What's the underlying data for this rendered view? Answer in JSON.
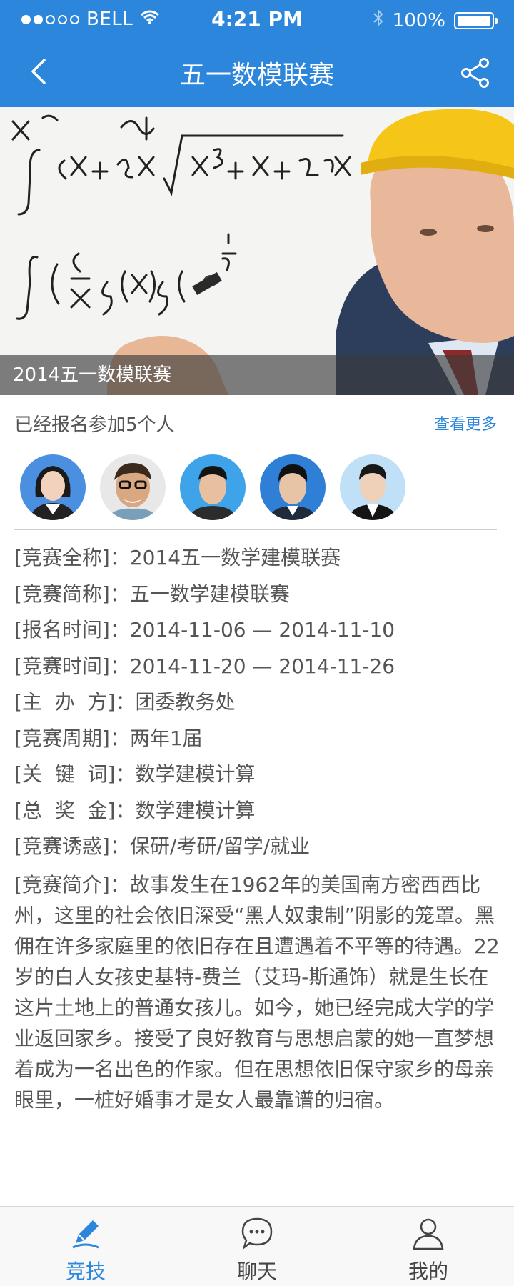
{
  "status_bar": {
    "carrier": "BELL",
    "time": "4:21 PM",
    "battery": "100%"
  },
  "nav": {
    "title": "五一数模联赛"
  },
  "banner": {
    "caption": "2014五一数模联赛"
  },
  "participants": {
    "count_text": "已经报名参加5个人",
    "more_label": "查看更多"
  },
  "details": [
    "[竞赛全称]：2014五一数学建模联赛",
    "[竞赛简称]：五一数学建模联赛",
    "[报名时间]：2014-11-06 — 2014-11-10",
    "[竞赛时间]：2014-11-20 — 2014-11-26",
    "[主  办  方]：团委教务处",
    "[竞赛周期]：两年1届",
    "[关  键  词]：数学建模计算",
    "[总  奖  金]：数学建模计算",
    "[竞赛诱惑]：保研/考研/留学/就业"
  ],
  "intro": "[竞赛简介]：故事发生在1962年的美国南方密西西比州，这里的社会依旧深受“黑人奴隶制”阴影的笼罩。黑佣在许多家庭里的依旧存在且遭遇着不平等的待遇。22岁的白人女孩史基特-费兰（艾玛-斯通饰）就是生长在这片土地上的普通女孩儿。如今，她已经完成大学的学业返回家乡。接受了良好教育与思想启蒙的她一直梦想着成为一名出色的作家。但在思想依旧保守家乡的母亲眼里，一桩好婚事才是女人最靠谱的归宿。",
  "tabs": [
    {
      "label": "竞技",
      "active": true
    },
    {
      "label": "聊天",
      "active": false
    },
    {
      "label": "我的",
      "active": false
    }
  ],
  "colors": {
    "primary": "#2c86dc",
    "text": "#555555"
  }
}
